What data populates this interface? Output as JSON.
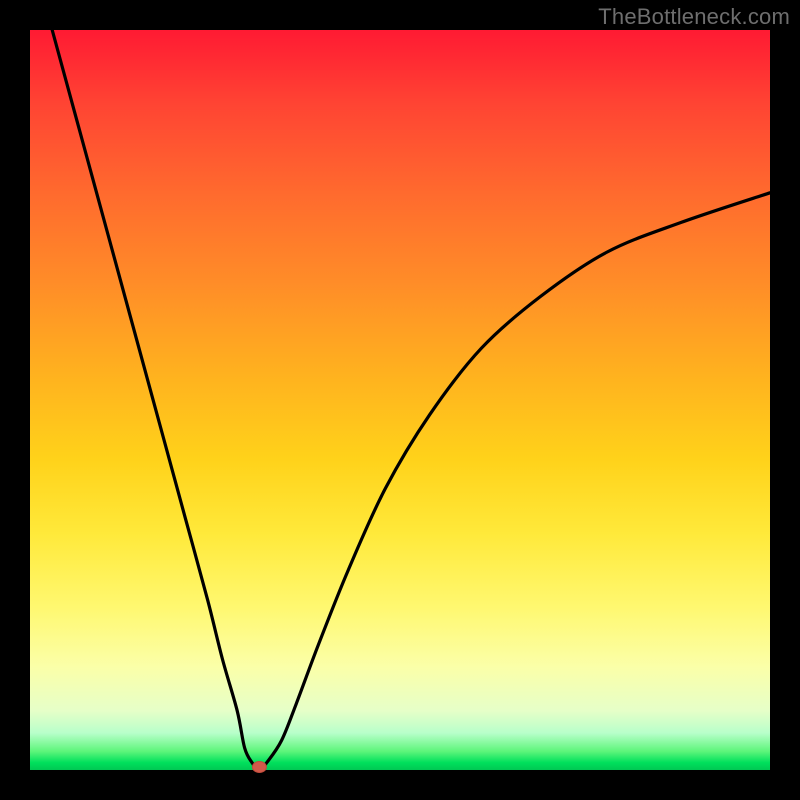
{
  "watermark": "TheBottleneck.com",
  "colors": {
    "frame": "#000000",
    "curve_stroke": "#000000",
    "marker_fill": "#d15a4a",
    "marker_stroke": "#c24b3c"
  },
  "chart_data": {
    "type": "line",
    "title": "",
    "xlabel": "",
    "ylabel": "",
    "xlim": [
      0,
      100
    ],
    "ylim": [
      0,
      100
    ],
    "grid": false,
    "legend": null,
    "minimum_marker": {
      "x": 31,
      "y": 0
    },
    "series": [
      {
        "name": "curve",
        "x": [
          3,
          6,
          9,
          12,
          15,
          18,
          21,
          24,
          26,
          28,
          29,
          30,
          31,
          32,
          34,
          36,
          39,
          43,
          48,
          54,
          61,
          69,
          78,
          88,
          100
        ],
        "y": [
          100,
          89,
          78,
          67,
          56,
          45,
          34,
          23,
          15,
          8,
          3,
          1,
          0,
          1,
          4,
          9,
          17,
          27,
          38,
          48,
          57,
          64,
          70,
          74,
          78
        ]
      }
    ],
    "background_gradient": "red-to-green vertical (red top, green bottom)"
  }
}
